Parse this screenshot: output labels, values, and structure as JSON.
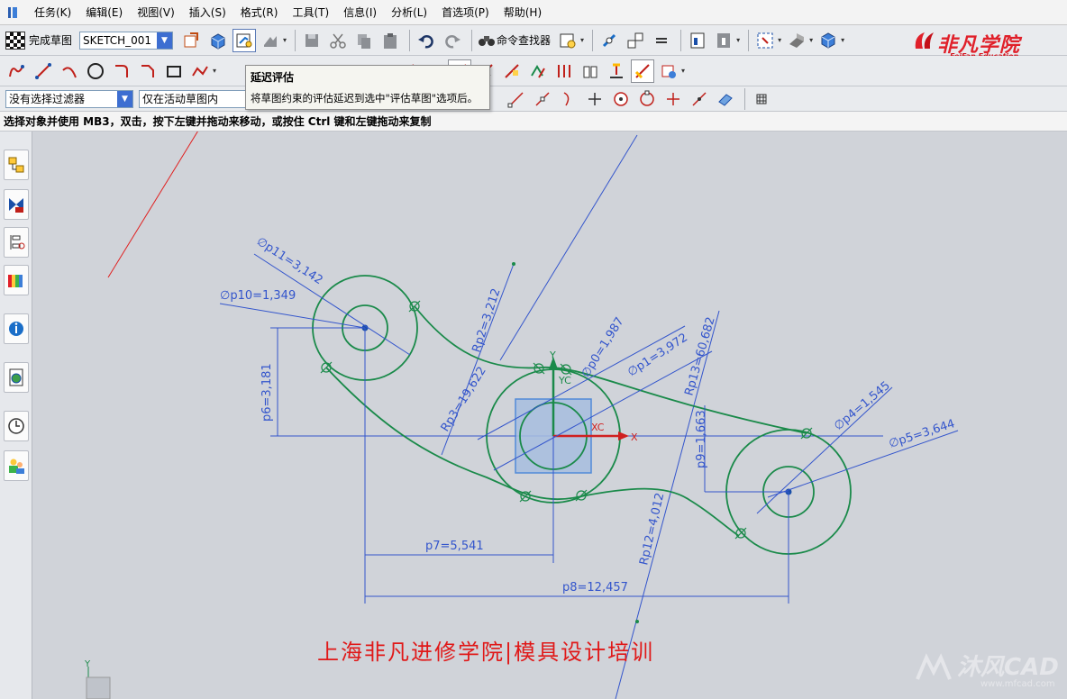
{
  "menubar": {
    "items": [
      "任务(K)",
      "编辑(E)",
      "视图(V)",
      "插入(S)",
      "格式(R)",
      "工具(T)",
      "信息(I)",
      "分析(L)",
      "首选项(P)",
      "帮助(H)"
    ]
  },
  "toolbar1": {
    "finish_label": "完成草图",
    "sketch_name": "SKETCH_001",
    "command_finder_label": "命令查找器"
  },
  "toolbar3": {
    "selection_filter": "没有选择过滤器",
    "scope_filter": "仅在活动草图内"
  },
  "status": {
    "prompt": "选择对象并使用 MB3，双击，按下左键并拖动来移动，或按住 Ctrl 键和左键拖动来复制"
  },
  "tooltip": {
    "title": "延迟评估",
    "description": "将草图约束的评估延迟到选中\"评估草图\"选项后。"
  },
  "logo": {
    "cn": "非凡学院",
    "en": "FeiFan Education"
  },
  "sketch": {
    "dimensions": {
      "p11": "∅p11=3,142",
      "p10": "∅p10=1,349",
      "p2": "Rp2=3,212",
      "p3": "Rp3=19,622",
      "p0": "∅p0=1,987",
      "p1": "∅p1=3,972",
      "p13": "Rp13=60,682",
      "p6": "p6=3,181",
      "p4": "∅p4=1,545",
      "p5": "∅p5=3,644",
      "p9": "p9=1,663",
      "p12": "Rp12=4,012",
      "p7": "p7=5,541",
      "p8": "p8=12,457"
    },
    "axes": {
      "x": "X",
      "y": "Y",
      "xc": "XC",
      "yc": "YC"
    }
  },
  "banner": "上海非凡进修学院|模具设计培训",
  "watermark": {
    "text": "沐风CAD",
    "url": "www.mfcad.com"
  },
  "colors": {
    "curve": "#1a8a4a",
    "dimension": "#3355cc",
    "tooltip_arrow": "#e02020",
    "canvas_bg": "#d0d3d9"
  }
}
